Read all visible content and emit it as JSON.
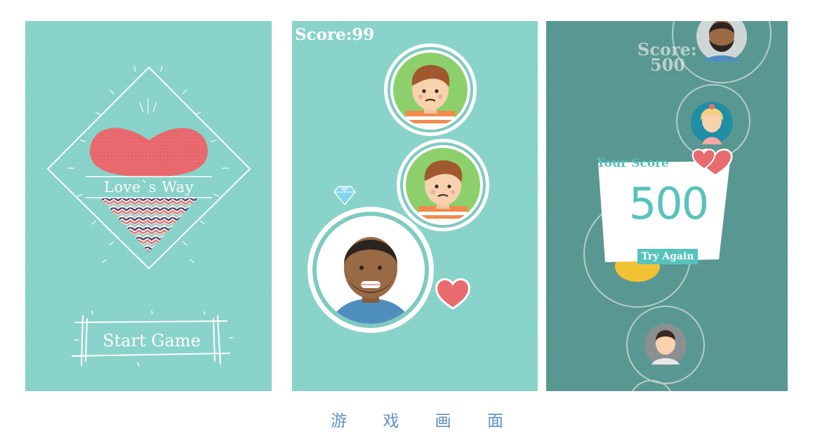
{
  "screens": {
    "start": {
      "logo_text": "Love`s Way",
      "start_button_label": "Start Game"
    },
    "play": {
      "score_text": "Score:99"
    },
    "gameover": {
      "bg_score_label": "Score:",
      "bg_score_value": "500",
      "card_title": "Your Score",
      "card_score": "500",
      "try_again_label": "Try Again"
    }
  },
  "caption": [
    "游",
    "戏",
    "画",
    "面"
  ],
  "colors": {
    "teal_bg": "#86d2c8",
    "dark_teal_bg": "#55958f",
    "heart_red": "#e96b6f",
    "score_teal": "#56c3bc",
    "caption_blue": "#5f8fc9"
  },
  "icons": [
    "heart-icon",
    "diamond-icon",
    "avatar-icon"
  ]
}
